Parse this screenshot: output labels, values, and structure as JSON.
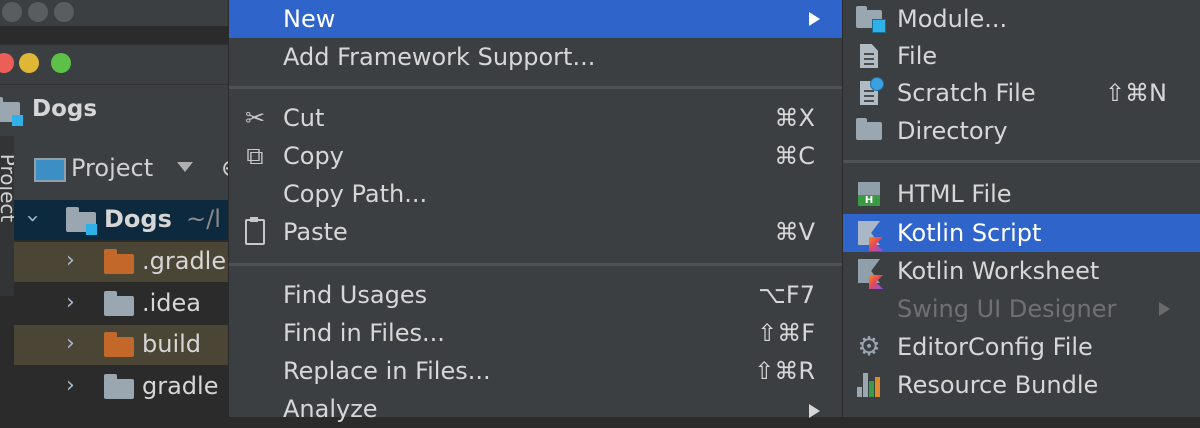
{
  "project": {
    "name": "Dogs",
    "tool_window_label": "Project",
    "side_tab_label": "Project",
    "root": {
      "name": "Dogs",
      "path_hint": "~/l"
    },
    "tree": [
      {
        "name": ".gradle",
        "color": "#c1682a"
      },
      {
        "name": ".idea",
        "color": "#9aa7b0"
      },
      {
        "name": "build",
        "color": "#c1682a"
      },
      {
        "name": "gradle",
        "color": "#9aa7b0"
      }
    ]
  },
  "context_menu": {
    "items": [
      {
        "label": "New",
        "shortcut": "",
        "submenu": true,
        "selected": true
      },
      {
        "label": "Add Framework Support...",
        "shortcut": ""
      },
      {
        "label": "Cut",
        "shortcut": "⌘X",
        "icon": "scissors-icon"
      },
      {
        "label": "Copy",
        "shortcut": "⌘C",
        "icon": "copy-icon"
      },
      {
        "label": "Copy Path...",
        "shortcut": ""
      },
      {
        "label": "Paste",
        "shortcut": "⌘V",
        "icon": "paste-icon"
      },
      {
        "label": "Find Usages",
        "shortcut": "⌥F7"
      },
      {
        "label": "Find in Files...",
        "shortcut": "⇧⌘F"
      },
      {
        "label": "Replace in Files...",
        "shortcut": "⇧⌘R"
      },
      {
        "label": "Analyze",
        "shortcut": "",
        "submenu": true
      }
    ]
  },
  "new_submenu": {
    "items": [
      {
        "label": "Module...",
        "icon": "module-folder-icon"
      },
      {
        "label": "File",
        "icon": "file-icon"
      },
      {
        "label": "Scratch File",
        "shortcut": "⇧⌘N",
        "icon": "scratch-file-icon"
      },
      {
        "label": "Directory",
        "icon": "folder-icon"
      },
      {
        "label": "HTML File",
        "icon": "html-file-icon"
      },
      {
        "label": "Kotlin Script",
        "icon": "kotlin-script-icon",
        "selected": true
      },
      {
        "label": "Kotlin Worksheet",
        "icon": "kotlin-worksheet-icon"
      },
      {
        "label": "Swing UI Designer",
        "disabled": true,
        "submenu": true
      },
      {
        "label": "EditorConfig File",
        "icon": "gear-icon"
      },
      {
        "label": "Resource Bundle",
        "icon": "resource-bundle-icon"
      }
    ]
  },
  "colors": {
    "selection": "#2f65ca",
    "menu_bg": "#3c3f41",
    "ide_bg": "#2b2b2b"
  }
}
